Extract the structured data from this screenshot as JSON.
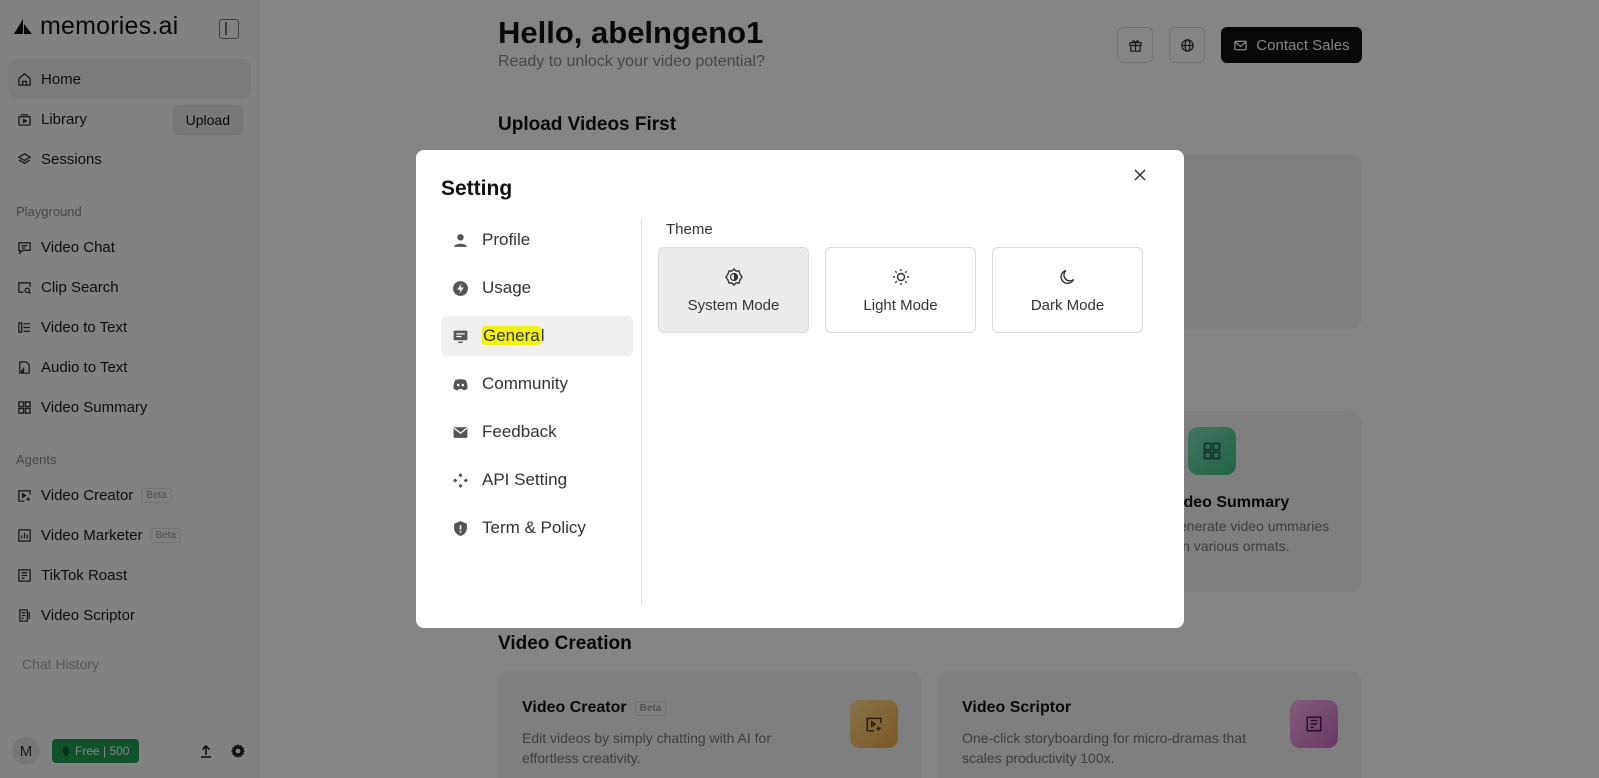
{
  "app": {
    "logo_text": "memories.ai"
  },
  "sidebar": {
    "home": "Home",
    "library": "Library",
    "upload": "Upload",
    "sessions": "Sessions",
    "playground_label": "Playground",
    "playground": [
      {
        "label": "Video Chat",
        "icon": "chat-icon"
      },
      {
        "label": "Clip Search",
        "icon": "image-search-icon"
      },
      {
        "label": "Video to Text",
        "icon": "text-list-icon"
      },
      {
        "label": "Audio to Text",
        "icon": "audio-file-icon"
      },
      {
        "label": "Video Summary",
        "icon": "grid-icon"
      }
    ],
    "agents_label": "Agents",
    "agents": [
      {
        "label": "Video Creator",
        "badge": "Beta"
      },
      {
        "label": "Video Marketer",
        "badge": "Beta"
      },
      {
        "label": "TikTok Roast",
        "badge": ""
      },
      {
        "label": "Video Scriptor",
        "badge": ""
      }
    ],
    "chat_history": "Chat History",
    "footer": {
      "avatar": "M",
      "plan": "Free | 500"
    }
  },
  "main": {
    "greeting": "Hello, abelngeno1",
    "subgreeting": "Ready to unlock your video potential?",
    "contact_sales": "Contact Sales",
    "upload_section": "Upload Videos First",
    "video_summary": {
      "title": "ideo Summary",
      "desc": "enerate video ummaries in various ormats."
    },
    "creation_section": "Video Creation",
    "video_creator": {
      "title": "Video Creator",
      "badge": "Beta",
      "desc": "Edit videos by simply chatting with AI for effortless creativity."
    },
    "video_scriptor": {
      "title": "Video Scriptor",
      "desc": "One-click storyboarding for micro-dramas that scales productivity 100x."
    }
  },
  "modal": {
    "title": "Setting",
    "menu": {
      "profile": "Profile",
      "usage": "Usage",
      "general_highlighted": "Genera",
      "general_rest": "l",
      "community": "Community",
      "feedback": "Feedback",
      "api": "API Setting",
      "terms": "Term & Policy"
    },
    "theme_label": "Theme",
    "themes": {
      "system": "System Mode",
      "light": "Light Mode",
      "dark": "Dark Mode",
      "selected": "system"
    }
  },
  "colors": {
    "plan_badge": "#1f9d55",
    "highlight": "#f2f21a",
    "contact_btn": "#111111"
  }
}
